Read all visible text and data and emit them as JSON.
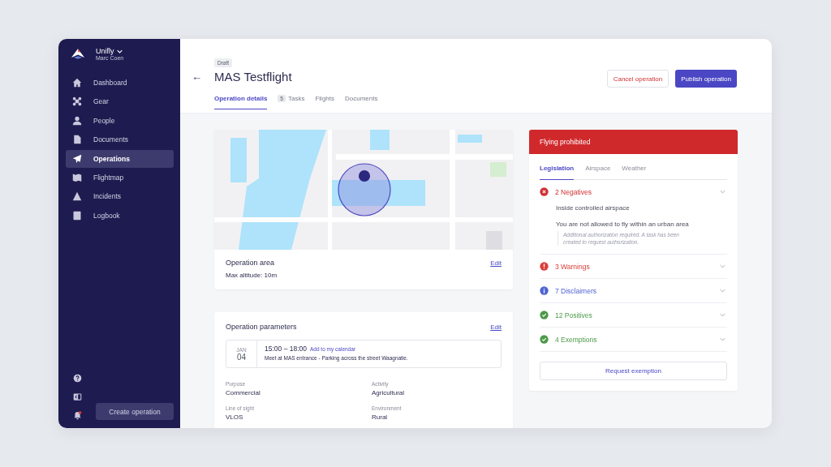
{
  "app": {
    "name": "Unifly",
    "user": "Marc Coen"
  },
  "sidebar": {
    "items": [
      {
        "label": "Dashboard",
        "selected": false
      },
      {
        "label": "Gear",
        "selected": false
      },
      {
        "label": "People",
        "selected": false
      },
      {
        "label": "Documents",
        "selected": false
      },
      {
        "label": "Operations",
        "selected": true
      },
      {
        "label": "Flightmap",
        "selected": false
      },
      {
        "label": "Incidents",
        "selected": false
      },
      {
        "label": "Logbook",
        "selected": false
      }
    ],
    "notifications_unread": true,
    "create_button": "Create operation"
  },
  "header": {
    "status": "Draft",
    "title": "MAS Testflight",
    "back": "←",
    "tabs": [
      {
        "label": "Operation details",
        "selected": true
      },
      {
        "label": "Tasks",
        "badge": "5",
        "selected": false
      },
      {
        "label": "Flights",
        "selected": false
      },
      {
        "label": "Documents",
        "selected": false
      }
    ],
    "cancel_button": "Cancel operation",
    "publish_button": "Publish operation"
  },
  "operation_area": {
    "title": "Operation area",
    "detail": "Max altitude: 10m",
    "edit": "Edit"
  },
  "operation_parameters": {
    "title": "Operation parameters",
    "edit": "Edit",
    "date": {
      "month": "JAN",
      "day": "04"
    },
    "time": "15:00 – 18:00",
    "calendar_link": "Add to my calendar",
    "note": "Meet at MAS entrance - Parking across the street Waagnatie.",
    "fields": [
      {
        "label": "Purpose",
        "value": "Commercial"
      },
      {
        "label": "Activity",
        "value": "Agricultural"
      },
      {
        "label": "Line of sight",
        "value": "VLOS"
      },
      {
        "label": "Environment",
        "value": "Rural"
      }
    ]
  },
  "status_panel": {
    "status": "Flying prohibited",
    "tabs": [
      {
        "label": "Legislation",
        "selected": true
      },
      {
        "label": "Airspace",
        "selected": false
      },
      {
        "label": "Weather",
        "selected": false
      }
    ],
    "checks": [
      {
        "label": "2 Negatives",
        "kind": "negative",
        "color": "#d03134",
        "expanded": true,
        "details": [
          {
            "text": "Inside controlled airspace"
          },
          {
            "text": "You are not allowed to fly within an urban area",
            "note": "Additional authorization required. A task has been created to request authorization."
          }
        ]
      },
      {
        "label": "3 Warnings",
        "kind": "warning",
        "color": "#d9413b",
        "expanded": false
      },
      {
        "label": "7 Disclaimers",
        "kind": "disclaimer",
        "color": "#4f63d2",
        "expanded": false
      },
      {
        "label": "12 Positives",
        "kind": "positive",
        "color": "#4d9a4a",
        "expanded": false
      },
      {
        "label": "4 Exemptions",
        "kind": "positive",
        "color": "#4d9a4a",
        "expanded": false
      }
    ],
    "button": "Request exemption"
  }
}
